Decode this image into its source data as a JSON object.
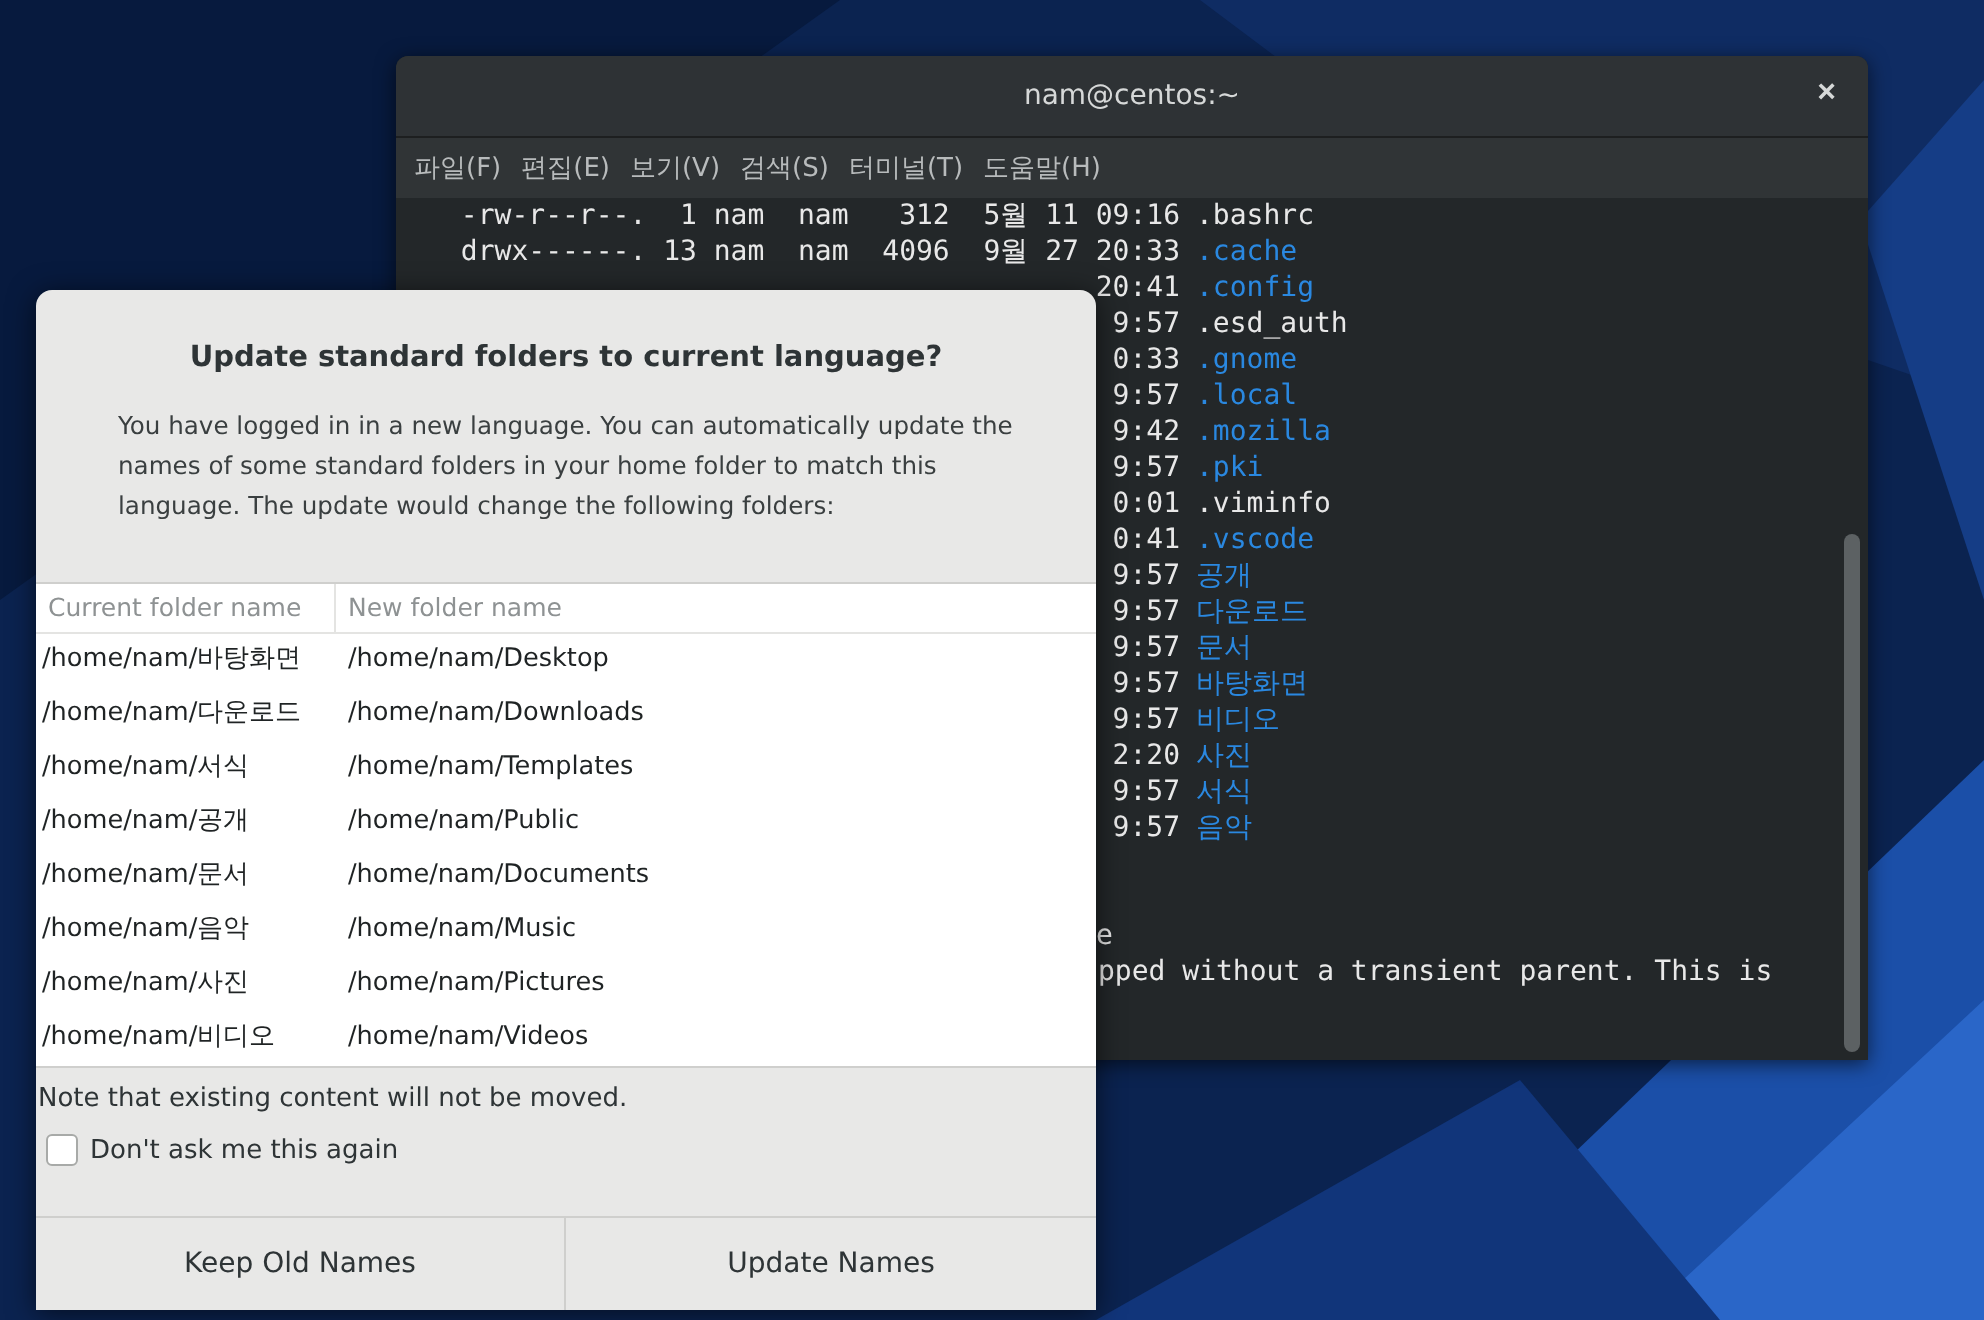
{
  "terminal": {
    "title": "nam@centos:~",
    "close": "×",
    "menu": [
      "파일(F)",
      "편집(E)",
      "보기(V)",
      "검색(S)",
      "터미널(T)",
      "도움말(H)"
    ],
    "lines": [
      {
        "prefix": "-rw-r--r--.  1 nam  nam   312  5월 11 09:16",
        "name": ".bashrc",
        "kind": "file"
      },
      {
        "prefix": "drwx------. 13 nam  nam  4096  9월 27 20:33",
        "name": ".cache",
        "kind": "dir"
      },
      {
        "prefix": "20:41",
        "name": ".config",
        "kind": "dir"
      },
      {
        "prefix": "9:57",
        "name": ".esd_auth",
        "kind": "file"
      },
      {
        "prefix": "0:33",
        "name": ".gnome",
        "kind": "dir"
      },
      {
        "prefix": "9:57",
        "name": ".local",
        "kind": "dir"
      },
      {
        "prefix": "9:42",
        "name": ".mozilla",
        "kind": "dir"
      },
      {
        "prefix": "9:57",
        "name": ".pki",
        "kind": "dir"
      },
      {
        "prefix": "0:01",
        "name": ".viminfo",
        "kind": "file"
      },
      {
        "prefix": "0:41",
        "name": ".vscode",
        "kind": "dir"
      },
      {
        "prefix": "9:57",
        "name": "공개",
        "kind": "dir"
      },
      {
        "prefix": "9:57",
        "name": "다운로드",
        "kind": "dir"
      },
      {
        "prefix": "9:57",
        "name": "문서",
        "kind": "dir"
      },
      {
        "prefix": "9:57",
        "name": "바탕화면",
        "kind": "dir"
      },
      {
        "prefix": "9:57",
        "name": "비디오",
        "kind": "dir"
      },
      {
        "prefix": "2:20",
        "name": "사진",
        "kind": "dir"
      },
      {
        "prefix": "9:57",
        "name": "서식",
        "kind": "dir"
      },
      {
        "prefix": "9:57",
        "name": "음악",
        "kind": "dir"
      }
    ],
    "tail": [
      "e",
      "pped without a transient parent. This is"
    ]
  },
  "dialog": {
    "title": "Update standard folders to current language?",
    "message": "You have logged in in a new language. You can automatically update the names of some standard folders in your home folder to match this language. The update would change the following folders:",
    "columns": [
      "Current folder name",
      "New folder name"
    ],
    "rows": [
      [
        "/home/nam/바탕화면",
        "/home/nam/Desktop"
      ],
      [
        "/home/nam/다운로드",
        "/home/nam/Downloads"
      ],
      [
        "/home/nam/서식",
        "/home/nam/Templates"
      ],
      [
        "/home/nam/공개",
        "/home/nam/Public"
      ],
      [
        "/home/nam/문서",
        "/home/nam/Documents"
      ],
      [
        "/home/nam/음악",
        "/home/nam/Music"
      ],
      [
        "/home/nam/사진",
        "/home/nam/Pictures"
      ],
      [
        "/home/nam/비디오",
        "/home/nam/Videos"
      ]
    ],
    "note": "Note that existing content will not be moved.",
    "checkbox": {
      "label": "Don't ask me this again",
      "checked": false
    },
    "buttons": [
      "Keep Old Names",
      "Update Names"
    ]
  }
}
